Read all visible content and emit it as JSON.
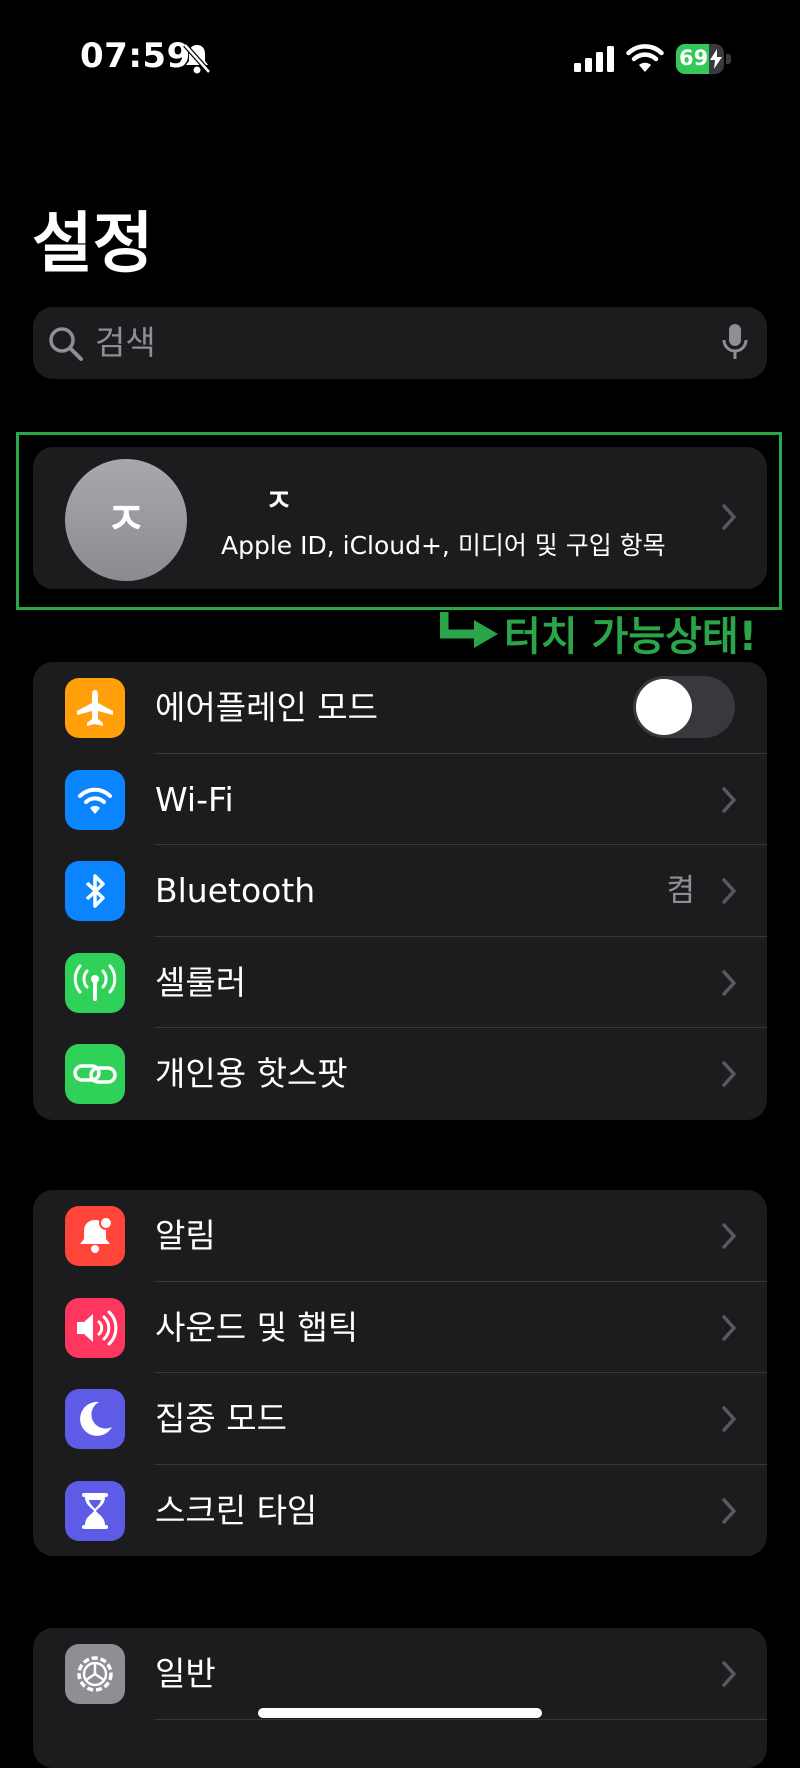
{
  "status_bar": {
    "time": "07:59",
    "battery": "69",
    "battery_level": 0.69
  },
  "page": {
    "title": "설정"
  },
  "search": {
    "placeholder": "검색"
  },
  "profile": {
    "initial": "ㅈ",
    "name": "ㅈ",
    "subtitle": "Apple ID, iCloud+, 미디어 및 구입 항목"
  },
  "annotation": {
    "text": "터치 가능상태!",
    "color": "#2aa54a"
  },
  "groups": [
    {
      "items": [
        {
          "label": "에어플레인 모드",
          "icon": "airplane-icon",
          "color": "#ff9f0a",
          "toggle": false
        },
        {
          "label": "Wi-Fi",
          "icon": "wifi-icon",
          "color": "#0a84ff"
        },
        {
          "label": "Bluetooth",
          "icon": "bluetooth-icon",
          "color": "#0a84ff",
          "value": "켬"
        },
        {
          "label": "셀룰러",
          "icon": "antenna-icon",
          "color": "#30d158"
        },
        {
          "label": "개인용 핫스팟",
          "icon": "hotspot-link-icon",
          "color": "#30d158"
        }
      ]
    },
    {
      "items": [
        {
          "label": "알림",
          "icon": "bell-badge-icon",
          "color": "#ff453a"
        },
        {
          "label": "사운드 및 햅틱",
          "icon": "speaker-icon",
          "color": "#ff375f"
        },
        {
          "label": "집중 모드",
          "icon": "moon-icon",
          "color": "#5e5ce6"
        },
        {
          "label": "스크린 타임",
          "icon": "hourglass-icon",
          "color": "#5e5ce6"
        }
      ]
    },
    {
      "items": [
        {
          "label": "일반",
          "icon": "gear-icon",
          "color": "#8e8e93"
        }
      ]
    }
  ]
}
